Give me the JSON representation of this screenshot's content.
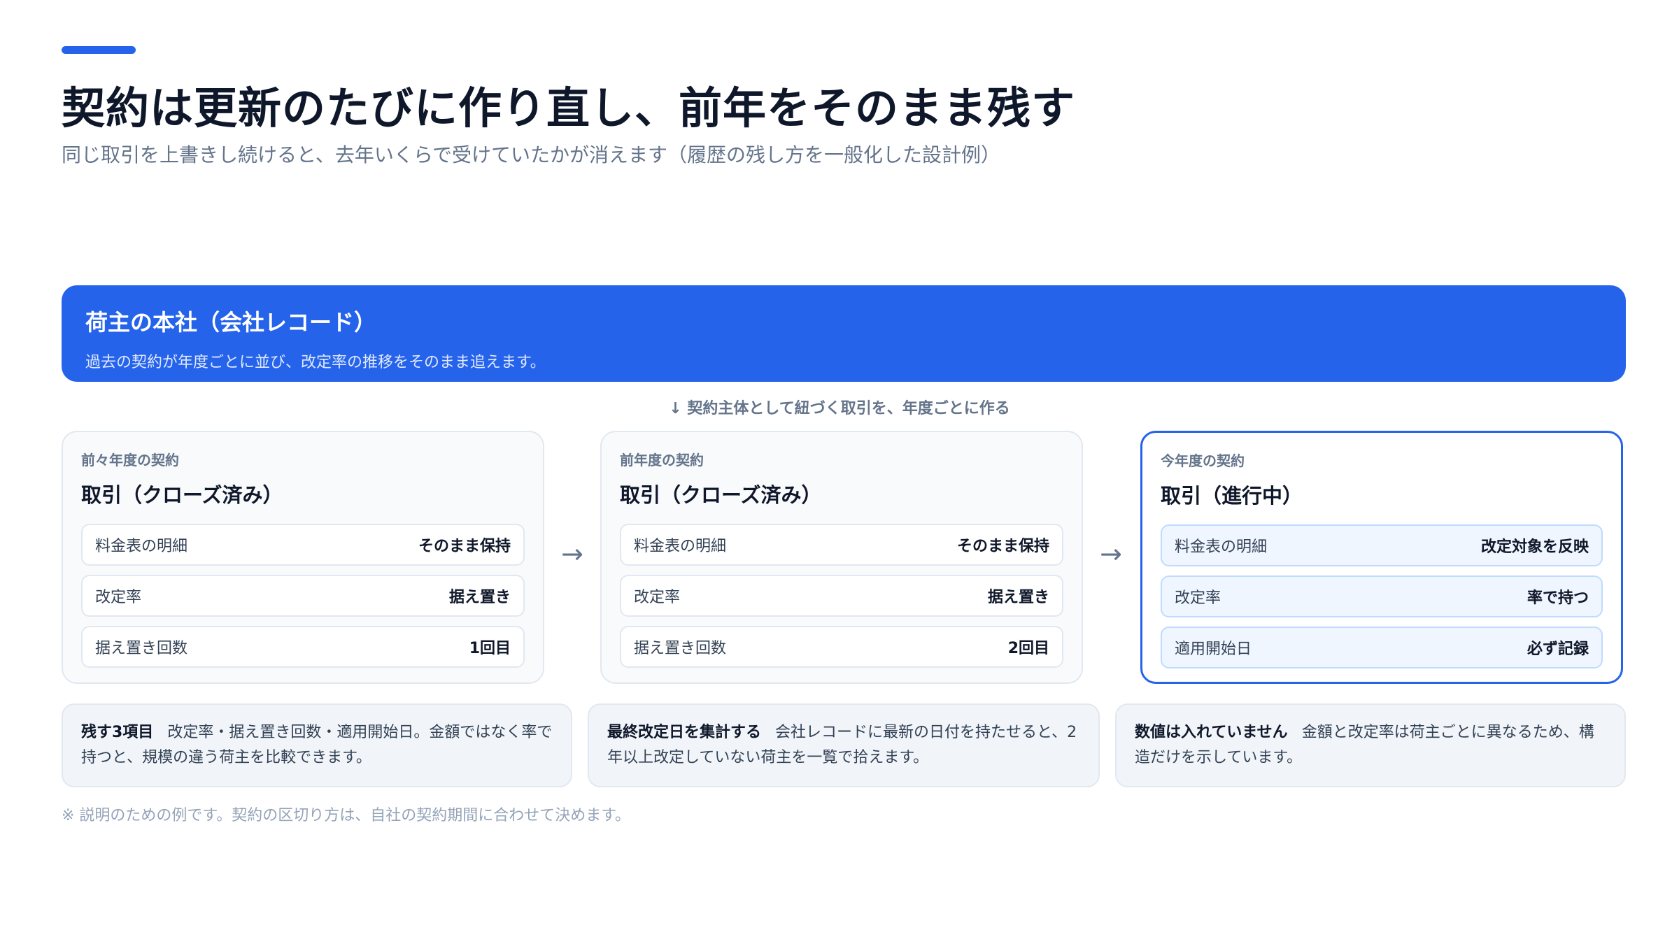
{
  "header": {
    "title": "契約は更新のたびに作り直し、前年をそのまま残す",
    "subtitle": "同じ取引を上書きし続けると、去年いくらで受けていたかが消えます（履歴の残し方を一般化した設計例）"
  },
  "company": {
    "title": "荷主の本社（会社レコード）",
    "description": "過去の契約が年度ごとに並び、改定率の推移をそのまま追えます。"
  },
  "flow_note": "↓ 契約主体として紐づく取引を、年度ごとに作る",
  "contracts": [
    {
      "label": "前々年度の契約",
      "title": "取引（クローズ済み）",
      "rows": [
        {
          "label": "料金表の明細",
          "value": "そのまま保持"
        },
        {
          "label": "改定率",
          "value": "据え置き"
        },
        {
          "label": "据え置き回数",
          "value": "1回目"
        }
      ]
    },
    {
      "label": "前年度の契約",
      "title": "取引（クローズ済み）",
      "rows": [
        {
          "label": "料金表の明細",
          "value": "そのまま保持"
        },
        {
          "label": "改定率",
          "value": "据え置き"
        },
        {
          "label": "据え置き回数",
          "value": "2回目"
        }
      ]
    },
    {
      "label": "今年度の契約",
      "title": "取引（進行中）",
      "rows": [
        {
          "label": "料金表の明細",
          "value": "改定対象を反映"
        },
        {
          "label": "改定率",
          "value": "率で持つ"
        },
        {
          "label": "適用開始日",
          "value": "必ず記録"
        }
      ]
    }
  ],
  "arrows": [
    "→",
    "→"
  ],
  "notes": [
    {
      "head": "残す3項目",
      "text": "改定率・据え置き回数・適用開始日。金額ではなく率で持つと、規模の違う荷主を比較できます。"
    },
    {
      "head": "最終改定日を集計する",
      "text": "会社レコードに最新の日付を持たせると、2年以上改定していない荷主を一覧で拾えます。"
    },
    {
      "head": "数値は入れていません",
      "text": "金額と改定率は荷主ごとに異なるため、構造だけを示しています。"
    }
  ],
  "footnote": "※ 説明のための例です。契約の区切り方は、自社の契約期間に合わせて決めます。",
  "colors": {
    "accent": "#2563eb",
    "title": "#0f172a",
    "muted": "#64748b"
  }
}
